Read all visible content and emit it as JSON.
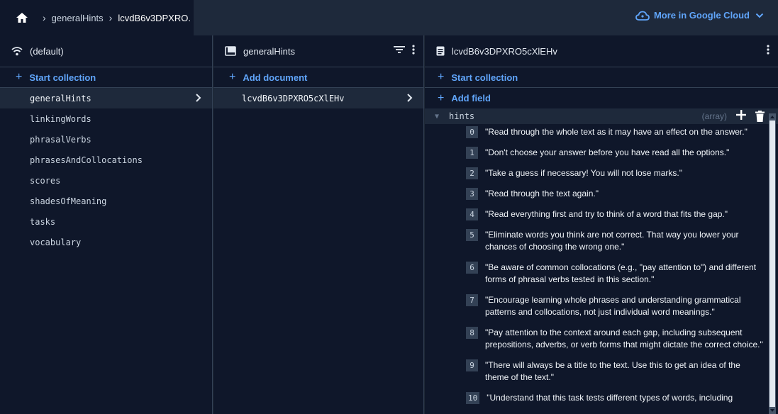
{
  "breadcrumb": {
    "items": [
      "generalHints",
      "lcvdB6v3DPXRO."
    ]
  },
  "header": {
    "cloud_link": "More in Google Cloud"
  },
  "databases": {
    "title": "(default)",
    "start_collection": "Start collection",
    "collections": [
      "generalHints",
      "linkingWords",
      "phrasalVerbs",
      "phrasesAndCollocations",
      "scores",
      "shadesOfMeaning",
      "tasks",
      "vocabulary"
    ]
  },
  "collection": {
    "title": "generalHints",
    "add_document": "Add document",
    "documents": [
      "lcvdB6v3DPXRO5cXlEHv"
    ]
  },
  "document": {
    "title": "lcvdB6v3DPXRO5cXlEHv",
    "start_collection": "Start collection",
    "add_field": "Add field",
    "field": {
      "name": "hints",
      "type": "(array)"
    },
    "hints": [
      {
        "i": "0",
        "t": "\"Read through the whole text as it may have an effect on the answer.\""
      },
      {
        "i": "1",
        "t": "\"Don't choose your answer before you have read all the options.\""
      },
      {
        "i": "2",
        "t": "\"Take a guess if necessary! You will not lose marks.\""
      },
      {
        "i": "3",
        "t": "\"Read through the text again.\""
      },
      {
        "i": "4",
        "t": "\"Read everything first and try to think of a word that fits the gap.\""
      },
      {
        "i": "5",
        "t": "\"Eliminate words you think are not correct. That way you lower your chances of choosing the wrong one.\""
      },
      {
        "i": "6",
        "t": "\"Be aware of common collocations (e.g., \"pay attention to\") and different forms of phrasal verbs tested in this section.\""
      },
      {
        "i": "7",
        "t": "\"Encourage learning whole phrases and understanding grammatical patterns and collocations, not just individual word meanings.\""
      },
      {
        "i": "8",
        "t": "\"Pay attention to the context around each gap, including subsequent prepositions, adverbs, or verb forms that might dictate the correct choice.\""
      },
      {
        "i": "9",
        "t": "\"There will always be a title to the text. Use this to get an idea of the theme of the text.\""
      },
      {
        "i": "10",
        "t": "\"Understand that this task tests different types of words, including"
      }
    ]
  },
  "colors": {
    "accent": "#60a5fa",
    "panel_bg": "#0f172a",
    "header_bg": "#1e293b"
  }
}
